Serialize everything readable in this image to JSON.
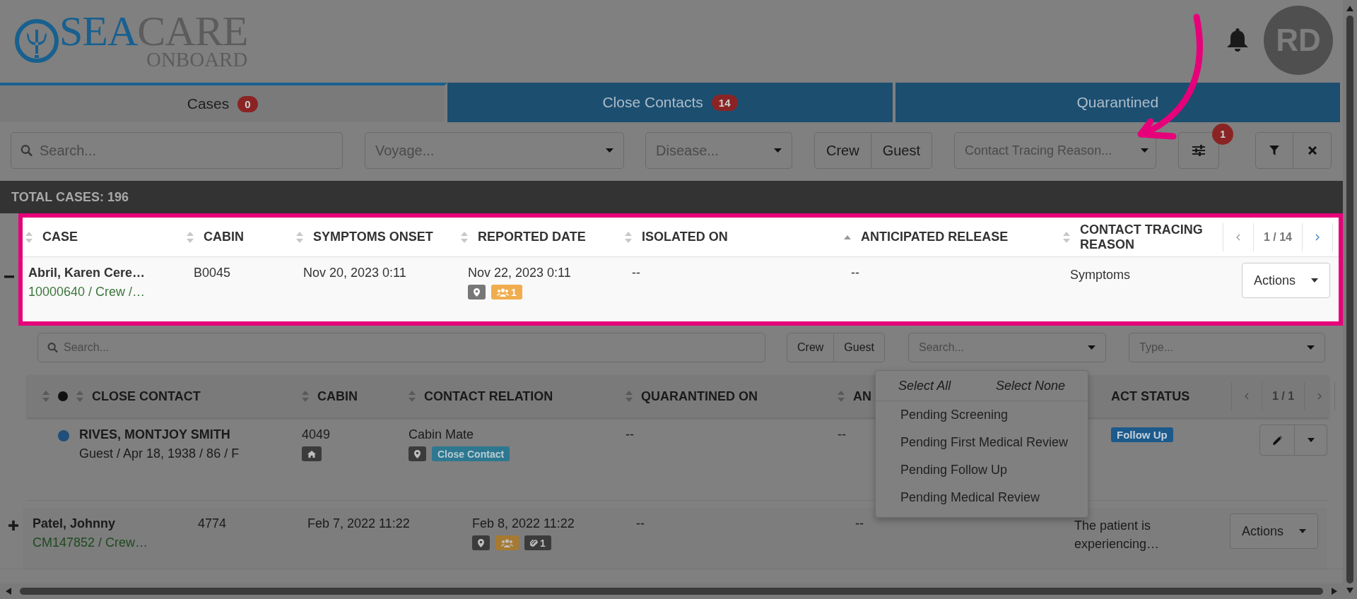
{
  "header": {
    "logo": {
      "part_1": "SEA",
      "part_2": "CARE",
      "tagline": "ONBOARD"
    },
    "avatar": "RD"
  },
  "tabs": [
    {
      "label": "Cases",
      "count": "0",
      "selected": true
    },
    {
      "label": "Close Contacts",
      "count": "14",
      "selected": false
    },
    {
      "label": "Quarantined",
      "selected": false
    }
  ],
  "filters": {
    "search_placeholder": "Search...",
    "voyage_placeholder": "Voyage...",
    "disease_placeholder": "Disease...",
    "person_toggle": [
      "Crew",
      "Guest"
    ],
    "reason_placeholder": "Contact Tracing Reason...",
    "settings_badge": "1"
  },
  "total_label": "TOTAL CASES: 196",
  "cases_table": {
    "columns": [
      {
        "label": "CASE",
        "sorted": false
      },
      {
        "label": "CABIN",
        "sorted": false
      },
      {
        "label": "SYMPTOMS ONSET",
        "sorted": false
      },
      {
        "label": "REPORTED DATE",
        "sorted": false
      },
      {
        "label": "ISOLATED ON",
        "sorted": false
      },
      {
        "label": "ANTICIPATED RELEASE",
        "sorted": true
      },
      {
        "label": "CONTACT TRACING REASON",
        "sorted": false
      }
    ],
    "pagination": "1 / 14",
    "rows": [
      {
        "expanded": true,
        "highlighted": true,
        "name": "Abril, Karen Cere…",
        "detail": "10000640 / Crew /…",
        "cabin": "B0045",
        "symptoms_onset": "Nov 20, 2023 0:11",
        "reported_date": "Nov 22, 2023 0:11",
        "tags": [
          {
            "kind": "location"
          },
          {
            "kind": "group",
            "count": "1"
          }
        ],
        "isolated_on": "--",
        "anticipated_release": "--",
        "reason": "Symptoms",
        "action": "Actions"
      },
      {
        "expanded": false,
        "highlighted": false,
        "name": "Patel, Johnny",
        "detail": "CM147852 / Crew…",
        "cabin": "4774",
        "symptoms_onset": "Feb 7, 2022 11:22",
        "reported_date": "Feb 8, 2022 11:22",
        "tags": [
          {
            "kind": "location"
          },
          {
            "kind": "group"
          },
          {
            "kind": "attachment",
            "count": "1"
          }
        ],
        "isolated_on": "--",
        "anticipated_release": "--",
        "reason": "The patient is experiencing…",
        "action": "Actions"
      }
    ]
  },
  "close_contacts": {
    "search_placeholder": "Search...",
    "person_toggle": [
      "Crew",
      "Guest"
    ],
    "status_placeholder": "Search...",
    "type_placeholder": "Type...",
    "columns": [
      {
        "label": "CLOSE CONTACT"
      },
      {
        "label": "CABIN"
      },
      {
        "label": "CONTACT RELATION"
      },
      {
        "label": "QUARANTINED ON"
      },
      {
        "label": "AN"
      },
      {
        "label": "ACT STATUS"
      }
    ],
    "pagination": "1 / 1",
    "rows": [
      {
        "color": "#1f4f7a",
        "name": "RIVES, MONTJOY SMITH",
        "detail": "Guest / Apr 18, 1938 / 86 / F",
        "cabin": "4049",
        "cabin_tags": [
          {
            "kind": "home"
          }
        ],
        "relation": "Cabin Mate",
        "relation_tags": [
          {
            "kind": "location"
          },
          {
            "kind": "label",
            "text": "Close Contact"
          }
        ],
        "quarantined_on": "--",
        "column_5": "--",
        "status": "Follow Up"
      }
    ],
    "status_dropdown": {
      "select_all": "Select All",
      "select_none": "Select None",
      "options": [
        "Pending Screening",
        "Pending First Medical Review",
        "Pending Follow Up",
        "Pending Medical Review"
      ]
    }
  }
}
